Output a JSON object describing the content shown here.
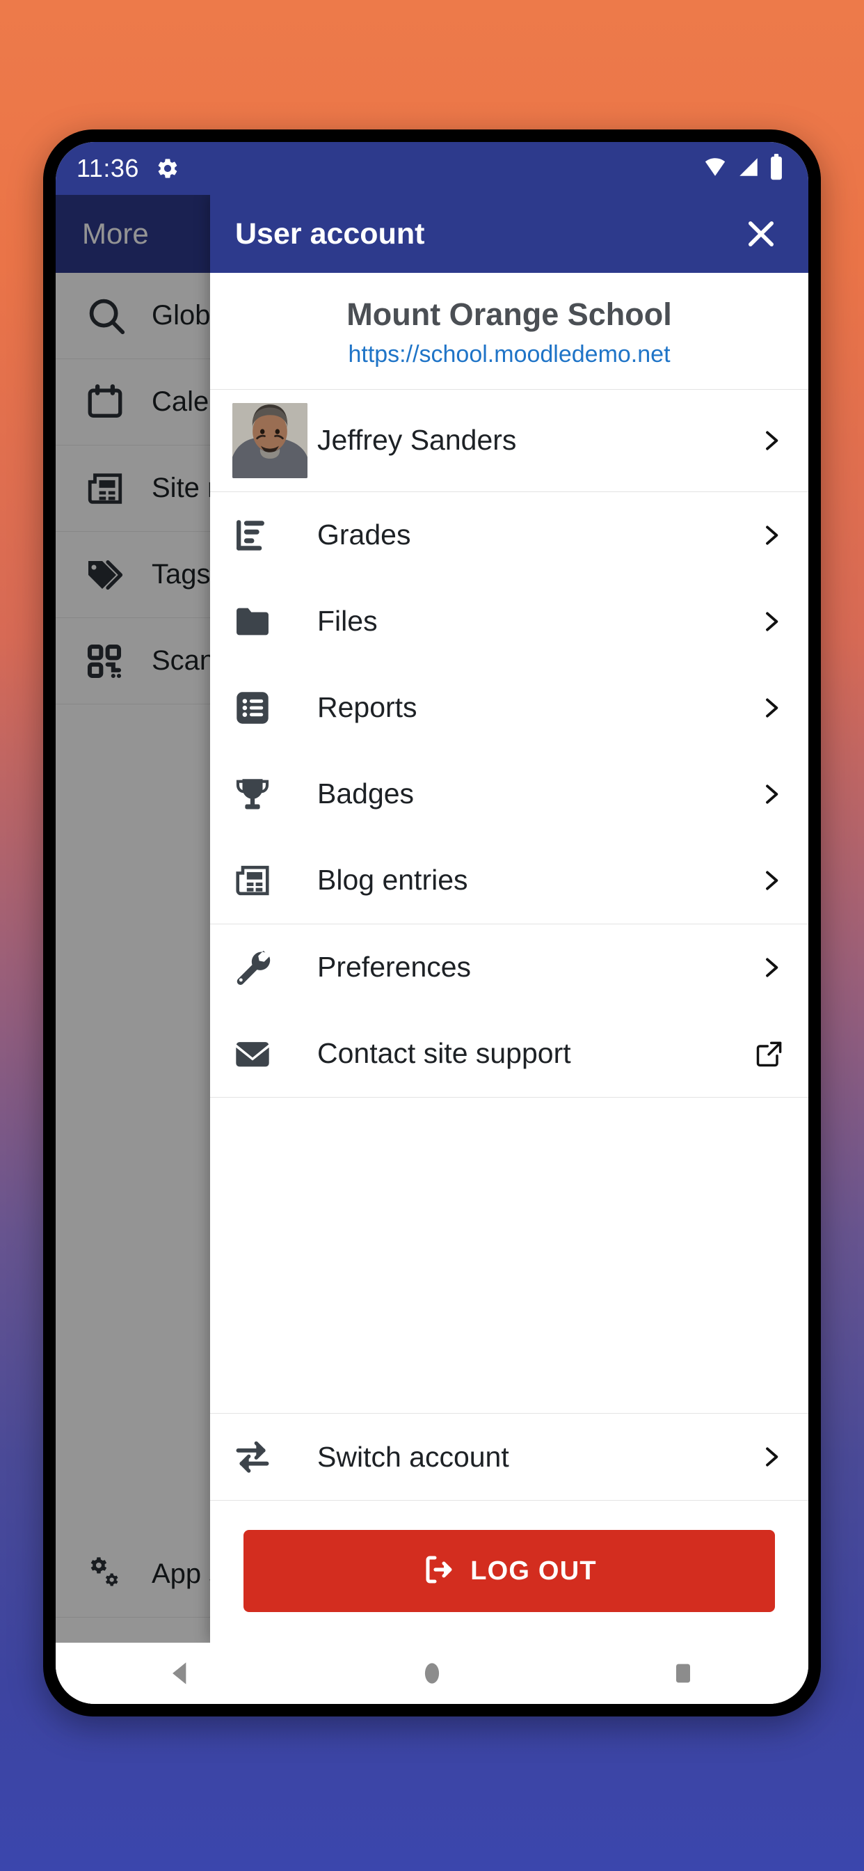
{
  "status_bar": {
    "time": "11:36",
    "icons": [
      "gear-icon",
      "wifi-icon",
      "cellular-signal-icon",
      "battery-icon"
    ]
  },
  "background_page": {
    "header_title": "More",
    "items": [
      {
        "icon": "search-icon",
        "label": "Global search"
      },
      {
        "icon": "calendar-icon",
        "label": "Calendar"
      },
      {
        "icon": "newspaper-icon",
        "label": "Site news"
      },
      {
        "icon": "tag-icon",
        "label": "Tags"
      },
      {
        "icon": "qr-code-icon",
        "label": "Scan QR code"
      }
    ],
    "bottom_items": [
      {
        "icon": "gears-icon",
        "label": "App settings"
      },
      {
        "icon": "graduation-cap-icon",
        "label": ""
      }
    ]
  },
  "modal": {
    "title": "User account",
    "close_icon": "close-icon",
    "site": {
      "name": "Mount Orange School",
      "url": "https://school.moodledemo.net",
      "url_color": "#1f74c7"
    },
    "user": {
      "name": "Jeffrey Sanders",
      "avatar": "user-avatar",
      "chevron": "chevron-right-icon"
    },
    "groups": [
      {
        "items": [
          {
            "icon": "grades-chart-icon",
            "label": "Grades",
            "trailing": "chevron-right-icon"
          },
          {
            "icon": "folder-icon",
            "label": "Files",
            "trailing": "chevron-right-icon"
          },
          {
            "icon": "list-icon",
            "label": "Reports",
            "trailing": "chevron-right-icon"
          },
          {
            "icon": "trophy-icon",
            "label": "Badges",
            "trailing": "chevron-right-icon"
          },
          {
            "icon": "newspaper-icon",
            "label": "Blog entries",
            "trailing": "chevron-right-icon"
          }
        ]
      },
      {
        "items": [
          {
            "icon": "wrench-icon",
            "label": "Preferences",
            "trailing": "chevron-right-icon"
          },
          {
            "icon": "envelope-icon",
            "label": "Contact site support",
            "trailing": "external-link-icon"
          }
        ]
      }
    ],
    "switch_account": {
      "icon": "switch-arrows-icon",
      "label": "Switch account",
      "trailing": "chevron-right-icon"
    },
    "logout": {
      "icon": "logout-icon",
      "label": "LOG OUT",
      "color": "#d32d1f"
    },
    "header_color": "#2d3a8c"
  },
  "nav_bar": {
    "buttons": [
      {
        "icon": "back-triangle-icon"
      },
      {
        "icon": "home-circle-icon"
      },
      {
        "icon": "recents-square-icon"
      }
    ]
  }
}
